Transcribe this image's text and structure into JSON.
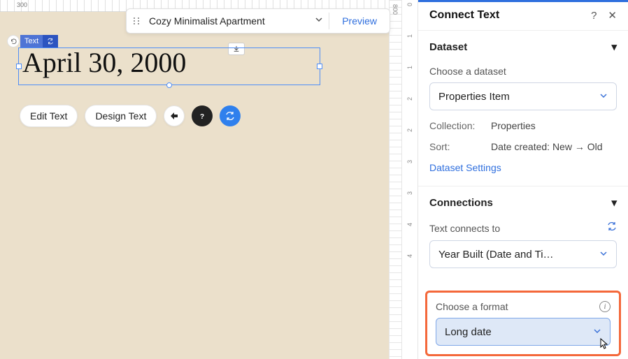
{
  "ruler": {
    "h_mark": "300",
    "v_mark": "800"
  },
  "topbar": {
    "title": "Cozy Minimalist Apartment",
    "preview": "Preview"
  },
  "badge": {
    "label": "Text"
  },
  "textbox": {
    "value": "April 30, 2000"
  },
  "toolbar": {
    "edit": "Edit Text",
    "design": "Design Text"
  },
  "panel": {
    "title": "Connect Text",
    "dataset": {
      "header": "Dataset",
      "choose_label": "Choose a dataset",
      "selected": "Properties Item",
      "collection_k": "Collection:",
      "collection_v": "Properties",
      "sort_k": "Sort:",
      "sort_v": "Date created: New → Old",
      "settings": "Dataset Settings"
    },
    "connections": {
      "header": "Connections",
      "connects_label": "Text connects to",
      "selected": "Year Built (Date and Ti…"
    },
    "format": {
      "label": "Choose a format",
      "selected": "Long date"
    }
  },
  "right_ruler": [
    "0",
    "1",
    "1",
    "2",
    "2",
    "3",
    "3",
    "4",
    "4"
  ]
}
